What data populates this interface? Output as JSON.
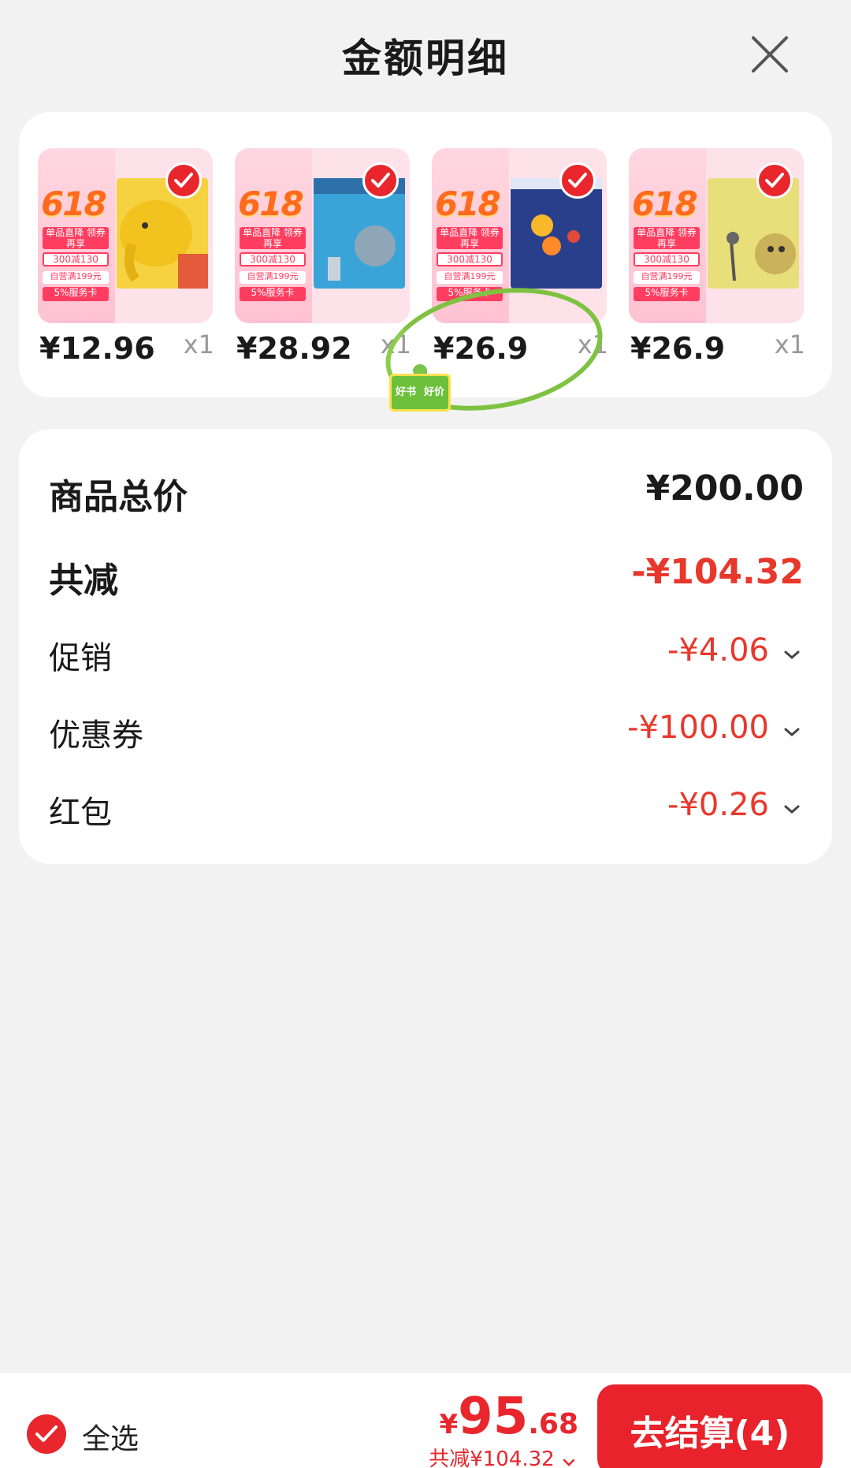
{
  "header": {
    "title": "金额明细"
  },
  "products": [
    {
      "price": "¥12.96",
      "qty": "x1",
      "book_color": "#f6d240",
      "promo": {
        "big": "618",
        "l1": "单品直降 领券再享",
        "l2": "300减130",
        "l3": "自营满199元",
        "l4": "5%服务卡"
      }
    },
    {
      "price": "¥28.92",
      "qty": "x1",
      "book_color": "#3aa4d8",
      "promo": {
        "big": "618",
        "l1": "单品直降 领券再享",
        "l2": "300减130",
        "l3": "自营满199元",
        "l4": "5%服务卡"
      }
    },
    {
      "price": "¥26.9",
      "qty": "x1",
      "book_color": "#2a3f8c",
      "promo": {
        "big": "618",
        "l1": "单品直降 领券再享",
        "l2": "300减130",
        "l3": "自营满199元",
        "l4": "5%服务卡"
      }
    },
    {
      "price": "¥26.9",
      "qty": "x1",
      "book_color": "#e8de7a",
      "promo": {
        "big": "618",
        "l1": "单品直降 领券再享",
        "l2": "300减130",
        "l3": "自营满199元",
        "l4": "5%服务卡"
      }
    }
  ],
  "stamp": {
    "left": "好书",
    "right": "好价"
  },
  "summary": {
    "total_label": "商品总价",
    "total_value": "¥200.00",
    "reduce_label": "共减",
    "reduce_value": "-¥104.32",
    "promo_label": "促销",
    "promo_value": "-¥4.06",
    "coupon_label": "优惠券",
    "coupon_value": "-¥100.00",
    "redpacket_label": "红包",
    "redpacket_value": "-¥0.26"
  },
  "footer": {
    "select_all": "全选",
    "total_symbol": "¥",
    "total_int": "95",
    "total_dec": ".68",
    "saved": "共减¥104.32",
    "checkout": "去结算(4)"
  },
  "colors": {
    "accent": "#e8262c",
    "price_red": "#e8382c",
    "circle_green": "#7fc241"
  }
}
